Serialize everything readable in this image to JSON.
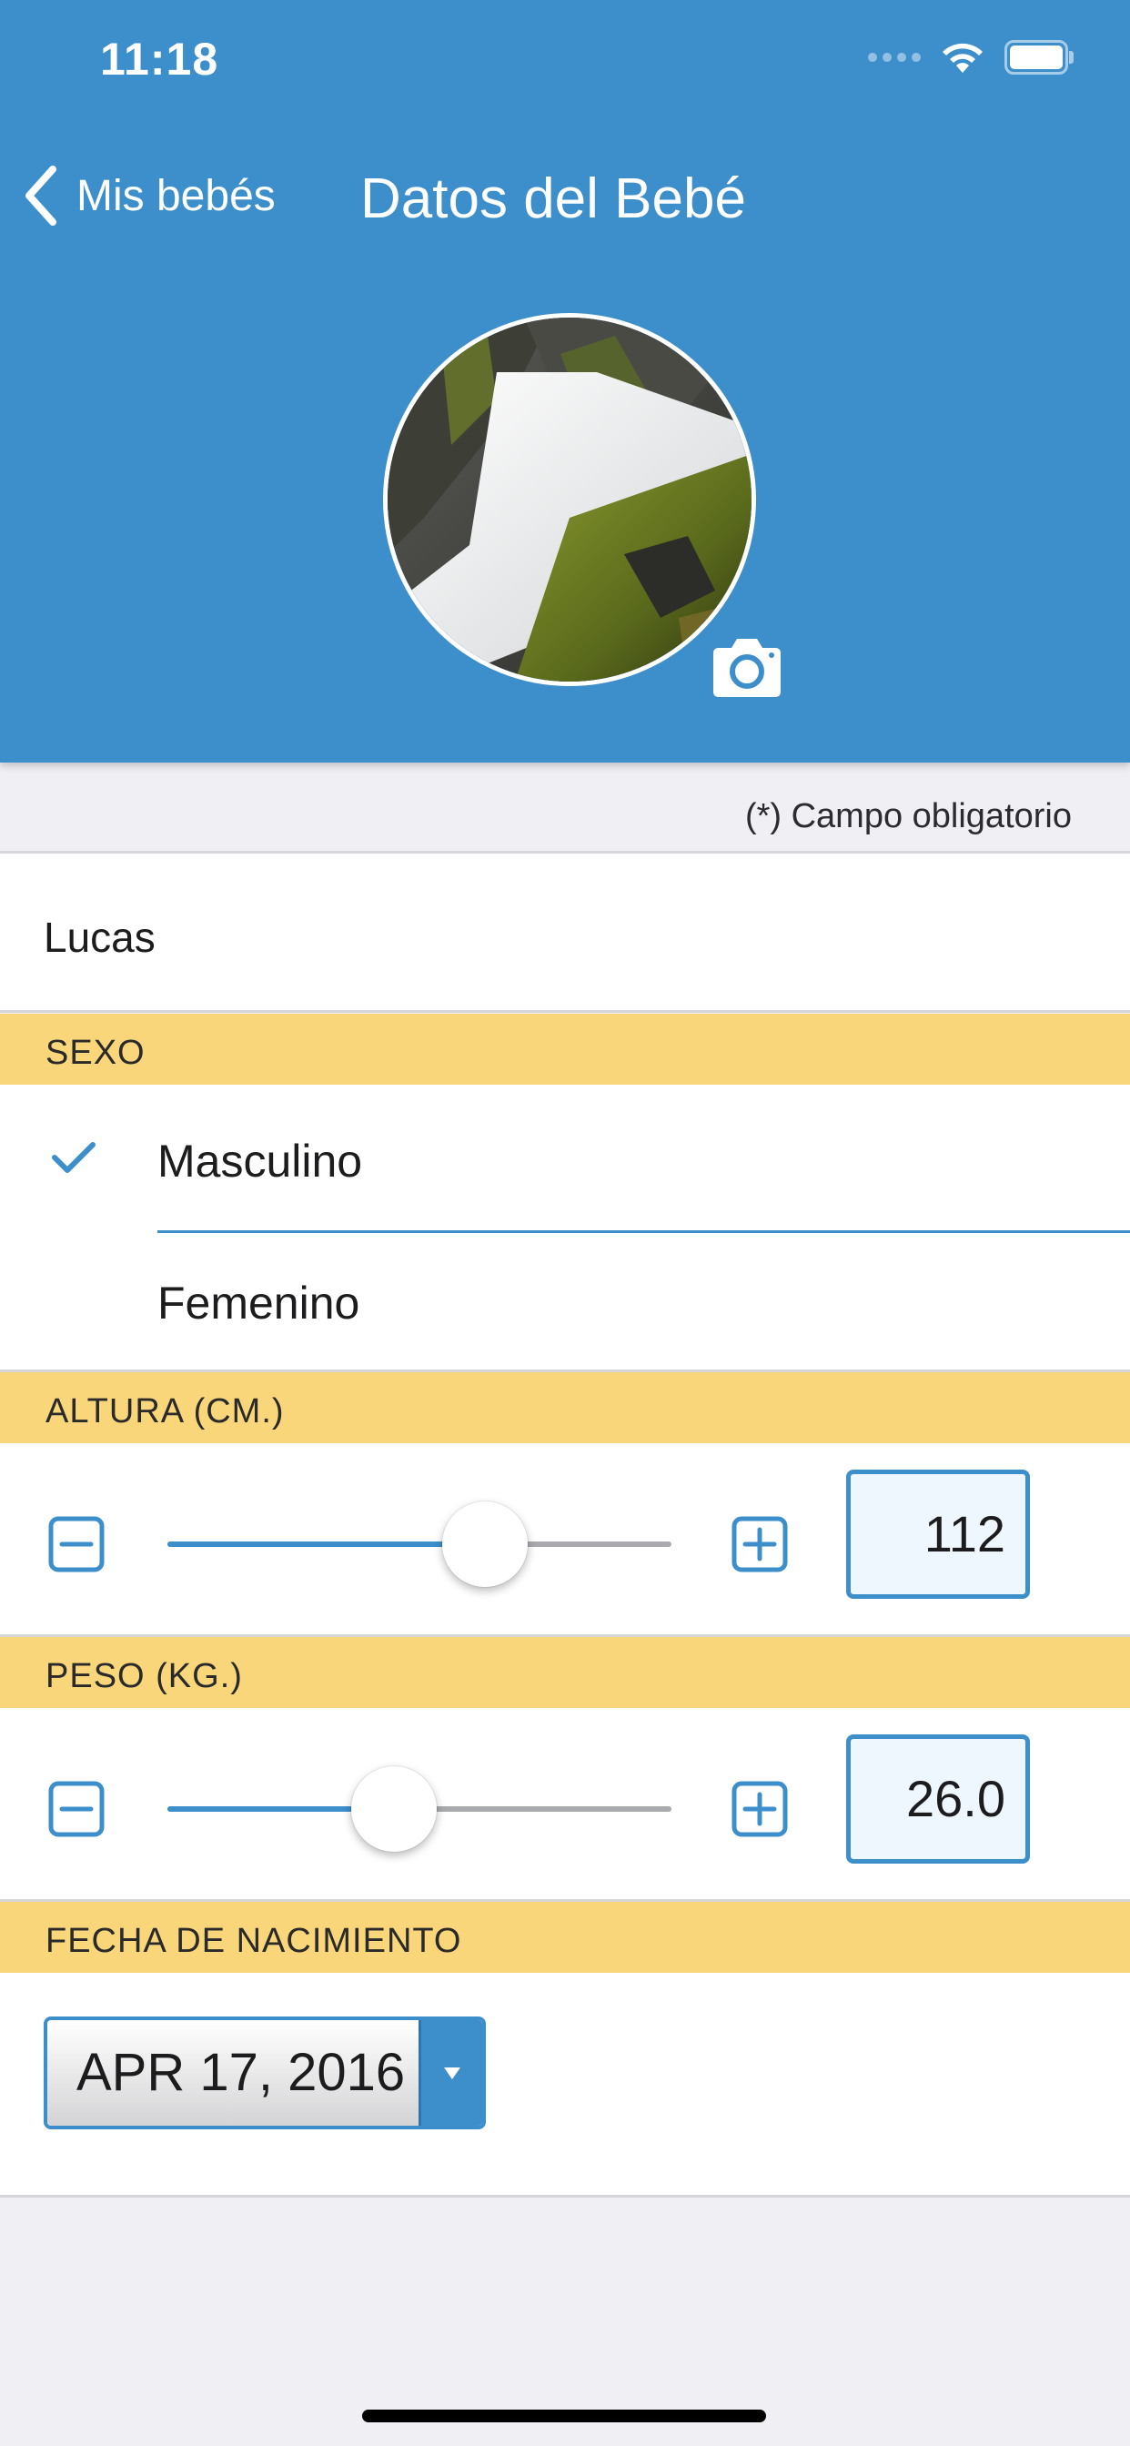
{
  "status_bar": {
    "time": "11:18"
  },
  "nav": {
    "back_label": "Mis bebés",
    "title": "Datos del Bebé"
  },
  "form": {
    "required_note": "(*) Campo obligatorio",
    "name_value": "Lucas",
    "sex": {
      "header": "SEXO",
      "options": [
        "Masculino",
        "Femenino"
      ],
      "selected": "Masculino"
    },
    "height": {
      "header": "ALTURA (CM.)",
      "value": "112",
      "slider_fraction": 0.63
    },
    "weight": {
      "header": "PESO (KG.)",
      "value": "26.0",
      "slider_fraction": 0.45
    },
    "birth_date": {
      "header": "FECHA DE NACIMIENTO",
      "value": "APR 17, 2016"
    }
  },
  "colors": {
    "accent": "#3d8fcc",
    "section_bar": "#f9d67a",
    "background": "#efeff4"
  },
  "icons": [
    "back-chevron-icon",
    "camera-icon",
    "checkmark-icon",
    "minus-icon",
    "plus-icon",
    "dropdown-arrow-icon",
    "wifi-icon",
    "battery-icon"
  ]
}
